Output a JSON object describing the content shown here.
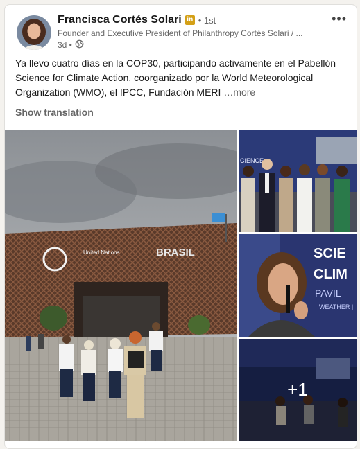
{
  "author": {
    "name": "Francisca Cortés Solari",
    "badge": "in",
    "degree": "• 1st",
    "headline": "Founder and Executive President of Philanthropy Cortés Solari / ...",
    "time": "3d •"
  },
  "post": {
    "text": "Ya llevo cuatro días en la COP30, participando activamente en el Pabellón Science for Climate Action, coorganizado por la World Meteorological Organization (WMO), el IPCC, Fundación MERI",
    "see_more": "…more",
    "translate": "Show translation"
  },
  "images": {
    "main": {
      "un_text": "United Nations",
      "brasil_text": "BRASIL"
    },
    "top_right": {
      "banner_text": "CIENCE"
    },
    "mid_right": {
      "line1": "SCIE",
      "line2": "CLIM",
      "line3": "PAVIL",
      "line4": "WEATHER |"
    },
    "bottom_right": {
      "more_count": "+1"
    }
  },
  "icons": {
    "menu": "more-horizontal-icon",
    "visibility": "globe-icon"
  }
}
